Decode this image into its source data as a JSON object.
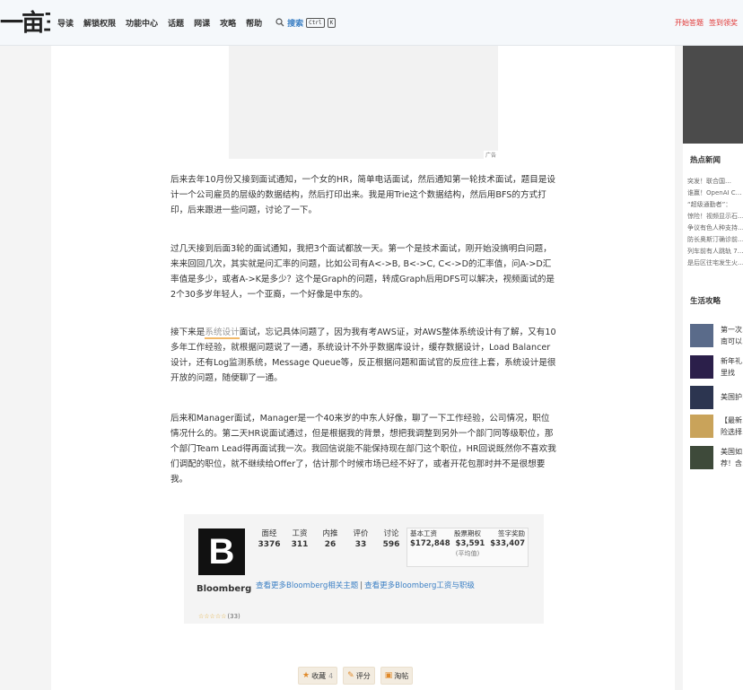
{
  "nav": {
    "logo_text": "一亩三分地",
    "items": [
      "导读",
      "解锁权限",
      "功能中心",
      "话题",
      "网课",
      "攻略",
      "帮助"
    ],
    "search_label": "搜索",
    "kbd_ctrl": "Ctrl",
    "kbd_k": "K",
    "right_links": [
      "开始答题",
      "签到领奖"
    ]
  },
  "ad": {
    "label": "广告"
  },
  "article": {
    "p1": "后来去年10月份又接到面试通知，一个女的HR，简单电话面试，然后通知第一轮技术面试，题目是设计一个公司雇员的层级的数据结构，然后打印出来。我是用Trie这个数据结构，然后用BFS的方式打印，后来跟进一些问题，讨论了一下。",
    "p2": "过几天接到后面3轮的面试通知，我把3个面试都放一天。第一个是技术面试，刚开始没搞明白问题，来来回回几次，其实就是问汇率的问题，比如公司有A<->B, B<->C, C<->D的汇率值，问A->D汇率值是多少，或者A->K是多少？这个是Graph的问题，转成Graph后用DFS可以解决，视频面试的是2个30多岁年轻人，一个亚裔，一个好像是中东的。",
    "p3_before": "接下来是",
    "p3_highlight": "系统设计",
    "p3_after": "面试，忘记具体问题了，因为我有考AWS证，对AWS整体系统设计有了解，又有10多年工作经验，就根据问题说了一通，系统设计不外乎数据库设计，缓存数据设计，Load Balancer设计，还有Log监测系统，Message Queue等，反正根据问题和面试官的反应往上套，系统设计是很开放的问题，随便聊了一通。",
    "p4": "后来和Manager面试，Manager是一个40来岁的中东人好像，聊了一下工作经验，公司情况，职位情况什么的。第二天HR说面试通过，但是根据我的背景，想把我调整到另外一个部门同等级职位，那个部门Team Lead得再面试我一次。我回信说能不能保持现在部门这个职位，HR回说既然你不喜欢我们调配的职位，就不继续给Offer了，估计那个时候市场已经不好了，或者开花包那时并不是很想要我。"
  },
  "company": {
    "logo_letter": "B",
    "name": "Bloomberg",
    "stars": "☆☆☆☆☆",
    "rating_count": "(33)",
    "stats": [
      {
        "label": "面经",
        "value": "3376"
      },
      {
        "label": "工资",
        "value": "311"
      },
      {
        "label": "内推",
        "value": "26"
      },
      {
        "label": "评价",
        "value": "33"
      },
      {
        "label": "讨论",
        "value": "596"
      }
    ],
    "salary": [
      {
        "label": "基本工资",
        "value": "$172,848"
      },
      {
        "label": "股票期权",
        "value": "$3,591"
      },
      {
        "label": "签字奖励",
        "value": "$33,407"
      }
    ],
    "salary_note": "(平均值)",
    "link1": "查看更多Bloomberg相关主题",
    "link_sep": "|",
    "link2": "查看更多Bloomberg工资与职级"
  },
  "actions": {
    "favorite": "收藏",
    "favorite_count": "4",
    "rate": "评分",
    "post": "淘帖"
  },
  "sidebar": {
    "hot_news_title": "热点新闻",
    "news_lines": [
      "突发！联合国…",
      "谁赢！OpenAI C…",
      "“超级通勤者”：",
      "惊险！视频显示石…",
      "争议有色人种支持…",
      "防长奥斯汀确诊前…",
      "列车前有人跳轨 7…",
      "是后区往宅发生火…"
    ],
    "life_title": "生活攻略",
    "life_items": [
      {
        "line1": "第一次…",
        "line2": "南可以…"
      },
      {
        "line1": "新年礼…",
        "line2": "里找"
      },
      {
        "line1": "美国护…",
        "line2": ""
      },
      {
        "line1": "【最新…",
        "line2": "险选择…"
      },
      {
        "line1": "美国如…",
        "line2": "荐！含…"
      }
    ]
  },
  "colors": {
    "accent_blue": "#3b7fc4",
    "accent_red": "#e0312f",
    "highlight_underline": "#f2b96a"
  }
}
